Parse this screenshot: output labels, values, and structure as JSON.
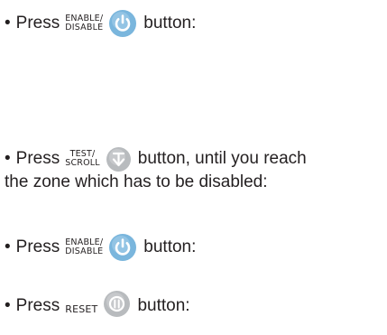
{
  "bullet": "•",
  "colors": {
    "text": "#231f20",
    "enable_button": "#79b5dc",
    "test_button": "#b9bcbf",
    "reset_button": "#b9bcbf"
  },
  "steps": [
    {
      "press": "Press",
      "button_label_line1": "ENABLE/",
      "button_label_line2": "DISABLE",
      "icon": "power-icon",
      "suffix": "button:"
    },
    {
      "press": "Press",
      "button_label_line1": "TEST/",
      "button_label_line2": "SCROLL",
      "icon": "scroll-down-icon",
      "suffix": "button, until you reach",
      "continuation": "the zone which has to be disabled:"
    },
    {
      "press": "Press",
      "button_label_line1": "ENABLE/",
      "button_label_line2": "DISABLE",
      "icon": "power-icon",
      "suffix": "button:"
    },
    {
      "press": "Press",
      "button_label": "RESET",
      "icon": "reset-icon",
      "suffix": "button:"
    }
  ]
}
